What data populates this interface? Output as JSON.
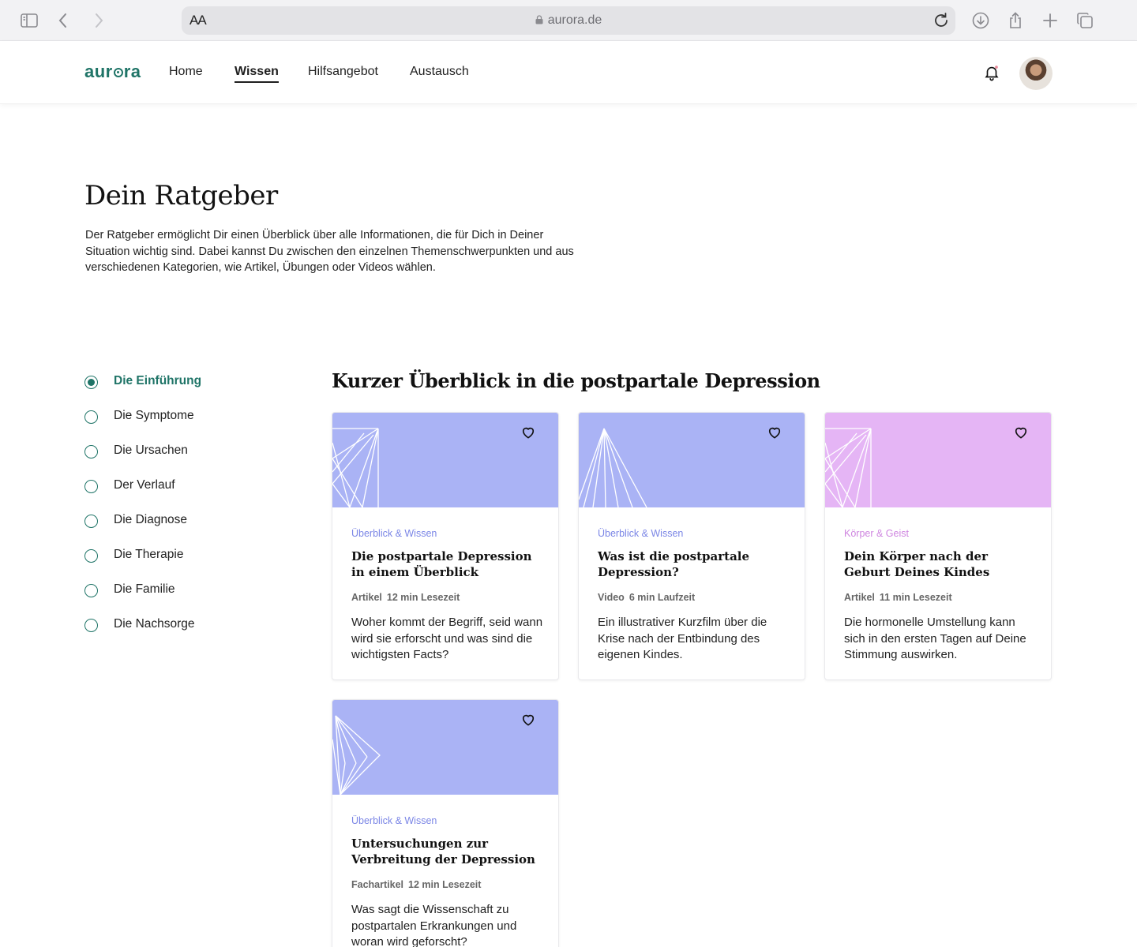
{
  "browser": {
    "text_size_label": "AA",
    "url": "aurora.de"
  },
  "site": {
    "logo": "aurora",
    "nav": [
      {
        "label": "Home"
      },
      {
        "label": "Wissen"
      },
      {
        "label": "Hilfsangebot"
      },
      {
        "label": "Austausch"
      }
    ],
    "active_nav": "Wissen"
  },
  "hero": {
    "title": "Dein Ratgeber",
    "intro": "Der Ratgeber ermöglicht Dir einen Überblick über alle Informationen, die für Dich in Deiner Situation wichtig sind. Dabei kannst Du zwischen den einzelnen Themenschwer­punkten und aus verschiedenen Kategorien, wie Artikel, Übungen oder Videos wählen."
  },
  "sidebar": {
    "items": [
      {
        "label": "Die Einführung",
        "selected": true
      },
      {
        "label": "Die Symptome",
        "selected": false
      },
      {
        "label": "Die Ursachen",
        "selected": false
      },
      {
        "label": "Der Verlauf",
        "selected": false
      },
      {
        "label": "Die Diagnose",
        "selected": false
      },
      {
        "label": "Die Therapie",
        "selected": false
      },
      {
        "label": "Die Familie",
        "selected": false
      },
      {
        "label": "Die Nachsorge",
        "selected": false
      }
    ]
  },
  "section": {
    "title": "Kurzer Überblick in die postpartale Depression",
    "cards": [
      {
        "category": "Überblick & Wissen",
        "category_color": "#7b86e6",
        "image_color": "#aab3f5",
        "title": "Die postpartale Depression in einem Überblick",
        "type": "Artikel",
        "duration": "12 min Lesezeit",
        "description": "Woher kommt der Begriff, seid wann wird sie erforscht und was sind die wichtigsten Facts?"
      },
      {
        "category": "Überblick & Wissen",
        "category_color": "#7b86e6",
        "image_color": "#aab3f5",
        "title": "Was ist die postpartale Depression?",
        "type": "Video",
        "duration": "6 min Laufzeit",
        "description": "Ein illustrativer Kurzfilm über die Krise nach der Entbindung des eigenen Kindes."
      },
      {
        "category": "Körper & Geist",
        "category_color": "#cf86e0",
        "image_color": "#e5b5f5",
        "title": "Dein Körper nach der Geburt Deines Kindes",
        "type": "Artikel",
        "duration": "11 min Lesezeit",
        "description": "Die hormonelle Umstellung kann sich in den ersten Tagen auf Deine Stimmung auswirken."
      },
      {
        "category": "Überblick & Wissen",
        "category_color": "#7b86e6",
        "image_color": "#aab3f5",
        "title": "Untersuchungen zur Verbreitung der Depression",
        "type": "Fachartikel",
        "duration": "12 min Lesezeit",
        "description": "Was sagt die Wissenschaft zu postpartalen Erkrankungen und woran wird geforscht?"
      }
    ]
  },
  "colors": {
    "brand": "#1f7467",
    "overview_bg": "#aab3f5",
    "body_mind_bg": "#e5b5f5"
  }
}
